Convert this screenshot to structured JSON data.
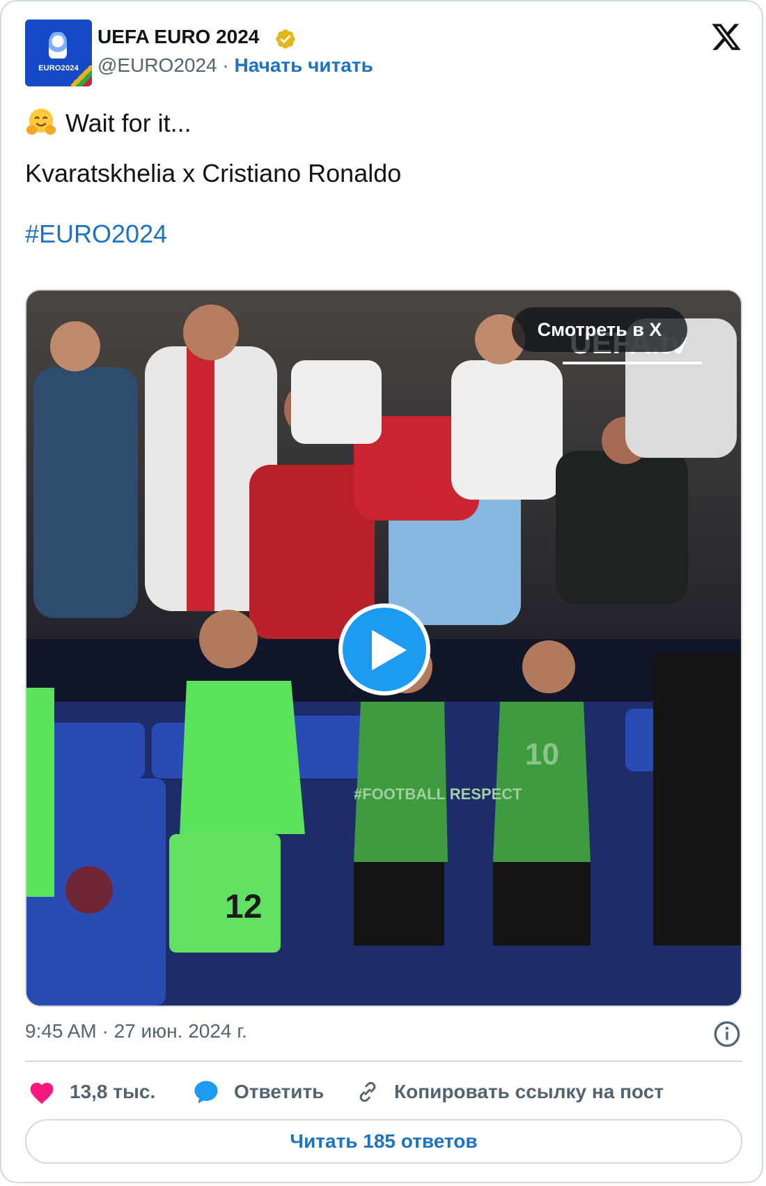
{
  "author": {
    "display_name": "UEFA EURO 2024",
    "handle": "@EURO2024",
    "separator": "·",
    "follow_label": "Начать читать",
    "avatar_text": "EURO2024",
    "verified_icon": "verified-badge-gold"
  },
  "post": {
    "line1": "Wait for it...",
    "line1_emoji": "hugging-face-emoji",
    "line2": "Kvaratskhelia x Cristiano Ronaldo",
    "hashtag": "#EURO2024"
  },
  "media": {
    "type": "video",
    "watch_label": "Смотреть в X",
    "play_icon": "play-icon",
    "scene_text": {
      "watermark": "UEFA.tv",
      "bib_text": "#FOOTBALL RESPECT",
      "shirt_number_keeper": "12",
      "shirt_number_bib": "10"
    }
  },
  "meta": {
    "timestamp": "9:45 AM · 27 июн. 2024 г.",
    "info_icon": "info-icon"
  },
  "actions": {
    "like_count": "13,8 тыс.",
    "reply_label": "Ответить",
    "copy_link_label": "Копировать ссылку на пост"
  },
  "read_replies_label": "Читать 185 ответов",
  "colors": {
    "link_blue": "#1d72c2",
    "play_blue": "#1d9bf0",
    "heart_pink": "#f91880",
    "reply_blue": "#1d9bf0",
    "border": "#cfd9de",
    "muted_text": "#536471"
  }
}
